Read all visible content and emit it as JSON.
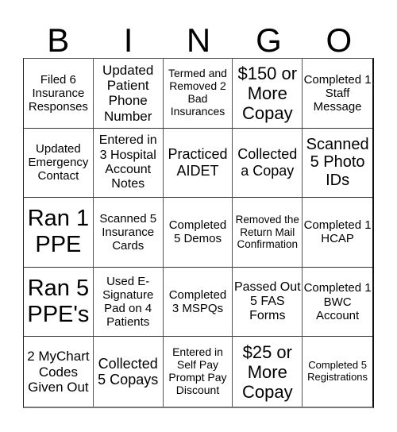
{
  "header": {
    "letters": [
      "B",
      "I",
      "N",
      "G",
      "O"
    ]
  },
  "board": {
    "cells": [
      "Filed 6 Insurance Responses",
      "Updated Patient Phone Number",
      "Termed and Removed 2 Bad Insurances",
      "$150 or More Copay",
      "Completed 1 Staff Message",
      "Updated Emergency Contact",
      "Entered in 3 Hospital Account Notes",
      "Practiced AIDET",
      "Collected a Copay",
      "Scanned 5 Photo IDs",
      "Ran 1 PPE",
      "Scanned 5 Insurance Cards",
      "Completed 5 Demos",
      "Removed the Return Mail Confirmation",
      "Completed 1 HCAP",
      "Ran 5 PPE's",
      "Used E-Signature Pad on 4 Patients",
      "Completed 3 MSPQs",
      "Passed Out 5 FAS Forms",
      "Completed 1 BWC Account",
      "2 MyChart Codes Given Out",
      "Collected 5 Copays",
      "Entered in Self Pay Prompt Pay Discount",
      "$25 or More Copay",
      "Completed 5 Registrations"
    ]
  }
}
